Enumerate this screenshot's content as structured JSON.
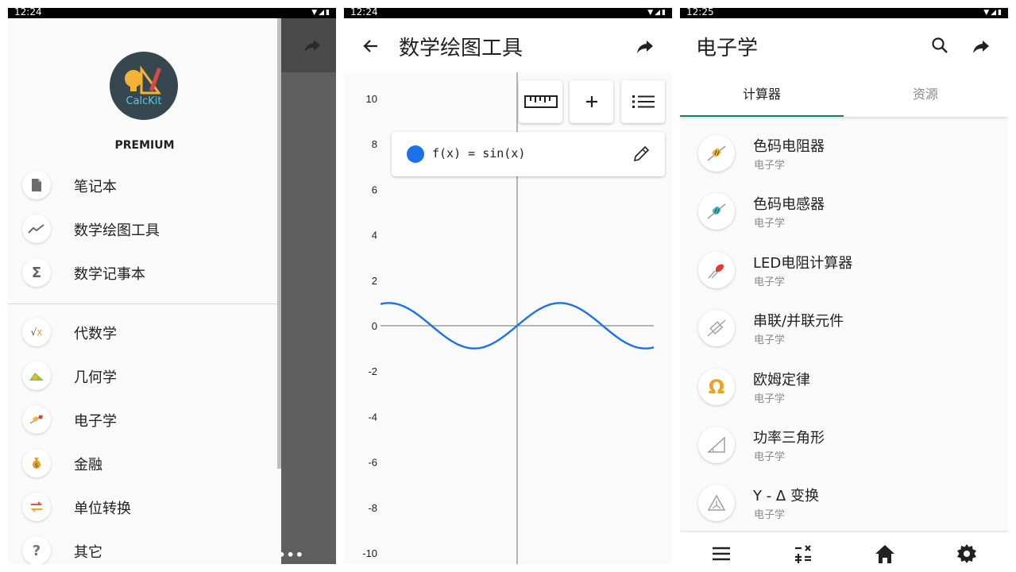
{
  "screens": [
    {
      "status_time": "12:24",
      "behind_more": "•••",
      "drawer": {
        "logo_text": "CalcKit",
        "badge": "PREMIUM",
        "top_items": [
          {
            "label": "笔记本",
            "icon": "document-icon"
          },
          {
            "label": "数学绘图工具",
            "icon": "trend-line-icon"
          },
          {
            "label": "数学记事本",
            "icon": "sigma-icon"
          }
        ],
        "category_items": [
          {
            "label": "代数学",
            "icon": "sqrt-x-icon"
          },
          {
            "label": "几何学",
            "icon": "geometry-icon"
          },
          {
            "label": "电子学",
            "icon": "resistor-icon"
          },
          {
            "label": "金融",
            "icon": "money-bag-icon"
          },
          {
            "label": "单位转换",
            "icon": "convert-arrows-icon"
          },
          {
            "label": "其它",
            "icon": "question-icon"
          }
        ]
      }
    },
    {
      "status_time": "12:24",
      "title": "数学绘图工具",
      "function_label": "f(x) = sin(x)",
      "function_color": "#1a73e8",
      "y_ticks": [
        "10",
        "8",
        "6",
        "4",
        "2",
        "0",
        "-2",
        "-4",
        "-6",
        "-8",
        "-10"
      ],
      "chart_data": {
        "type": "line",
        "series": [
          {
            "name": "f(x) = sin(x)",
            "function": "sin(x)"
          }
        ],
        "x_range": [
          -6,
          6
        ],
        "ylim": [
          -10,
          10
        ],
        "yticks": [
          10,
          8,
          6,
          4,
          2,
          0,
          -2,
          -4,
          -6,
          -8,
          -10
        ]
      }
    },
    {
      "status_time": "12:25",
      "title": "电子学",
      "tabs": [
        {
          "label": "计算器",
          "active": true
        },
        {
          "label": "资源",
          "active": false
        }
      ],
      "items": [
        {
          "title": "色码电阻器",
          "subtitle": "电子学",
          "icon": "resistor-icon"
        },
        {
          "title": "色码电感器",
          "subtitle": "电子学",
          "icon": "inductor-icon"
        },
        {
          "title": "LED电阻计算器",
          "subtitle": "电子学",
          "icon": "led-icon"
        },
        {
          "title": "串联/并联元件",
          "subtitle": "电子学",
          "icon": "series-parallel-icon"
        },
        {
          "title": "欧姆定律",
          "subtitle": "电子学",
          "icon": "omega-icon",
          "glyph": "Ω"
        },
        {
          "title": "功率三角形",
          "subtitle": "电子学",
          "icon": "power-triangle-icon"
        },
        {
          "title": "Y - Δ 变换",
          "subtitle": "电子学",
          "icon": "y-delta-icon"
        }
      ],
      "bottom_nav": [
        "menu-icon",
        "calculator-icon",
        "home-icon",
        "settings-icon"
      ]
    }
  ],
  "colors": {
    "accent": "#1e7a74",
    "graph_line": "#1a73e8",
    "omega": "#f0a020"
  }
}
